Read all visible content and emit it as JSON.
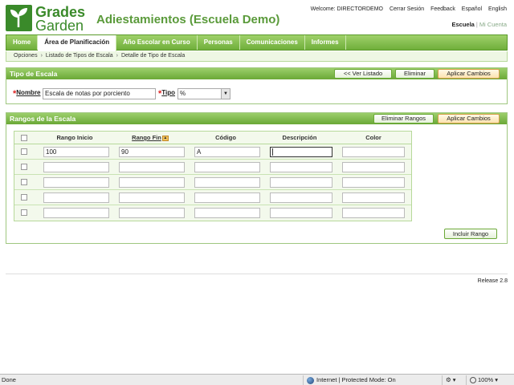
{
  "brand": {
    "name_line1": "Grades",
    "name_line2": "Garden"
  },
  "header": {
    "title": "Adiestamientos (Escuela Demo)",
    "welcome": "Welcome: DIRECTORDEMO",
    "links": [
      "Cerrar Sesión",
      "Feedback",
      "Español",
      "English"
    ],
    "school_active": "Escuela",
    "school_other": "Mi Cuenta"
  },
  "nav": {
    "items": [
      "Home",
      "Área de Planificación",
      "Año Escolar en Curso",
      "Personas",
      "Comunicaciones",
      "Informes"
    ],
    "active_index": 1
  },
  "breadcrumb": [
    "Opciones",
    "Listado de Tipos de Escala",
    "Detalle de Tipo de Escala"
  ],
  "tipo_panel": {
    "title": "Tipo de Escala",
    "buttons": {
      "list": "<< Ver Listado",
      "delete": "Eliminar",
      "apply": "Aplicar Cambios"
    },
    "nombre_label": "Nombre",
    "nombre_value": "Escala de notas por porciento",
    "tipo_label": "Tipo",
    "tipo_value": "%"
  },
  "rangos_panel": {
    "title": "Rangos de la Escala",
    "buttons": {
      "delete_ranges": "Eliminar Rangos",
      "apply": "Aplicar Cambios",
      "add_range": "Incluir Rango"
    },
    "columns": [
      "Rango Inicio",
      "Rango Fin",
      "Código",
      "Descripción",
      "Color"
    ],
    "rows": [
      {
        "inicio": "100",
        "fin": "90",
        "codigo": "A",
        "descripcion": "",
        "color": ""
      },
      {
        "inicio": "",
        "fin": "",
        "codigo": "",
        "descripcion": "",
        "color": ""
      },
      {
        "inicio": "",
        "fin": "",
        "codigo": "",
        "descripcion": "",
        "color": ""
      },
      {
        "inicio": "",
        "fin": "",
        "codigo": "",
        "descripcion": "",
        "color": ""
      },
      {
        "inicio": "",
        "fin": "",
        "codigo": "",
        "descripcion": "",
        "color": ""
      }
    ]
  },
  "footer": {
    "release": "Release 2.8"
  },
  "statusbar": {
    "left": "Done",
    "zone": "Internet | Protected Mode: On",
    "zoom": "100%"
  },
  "colors": {
    "brand_green": "#3a8a2a",
    "nav_green": "#6fae3a",
    "required_red": "#d22222",
    "apply_orange": "#fbe3b0"
  }
}
